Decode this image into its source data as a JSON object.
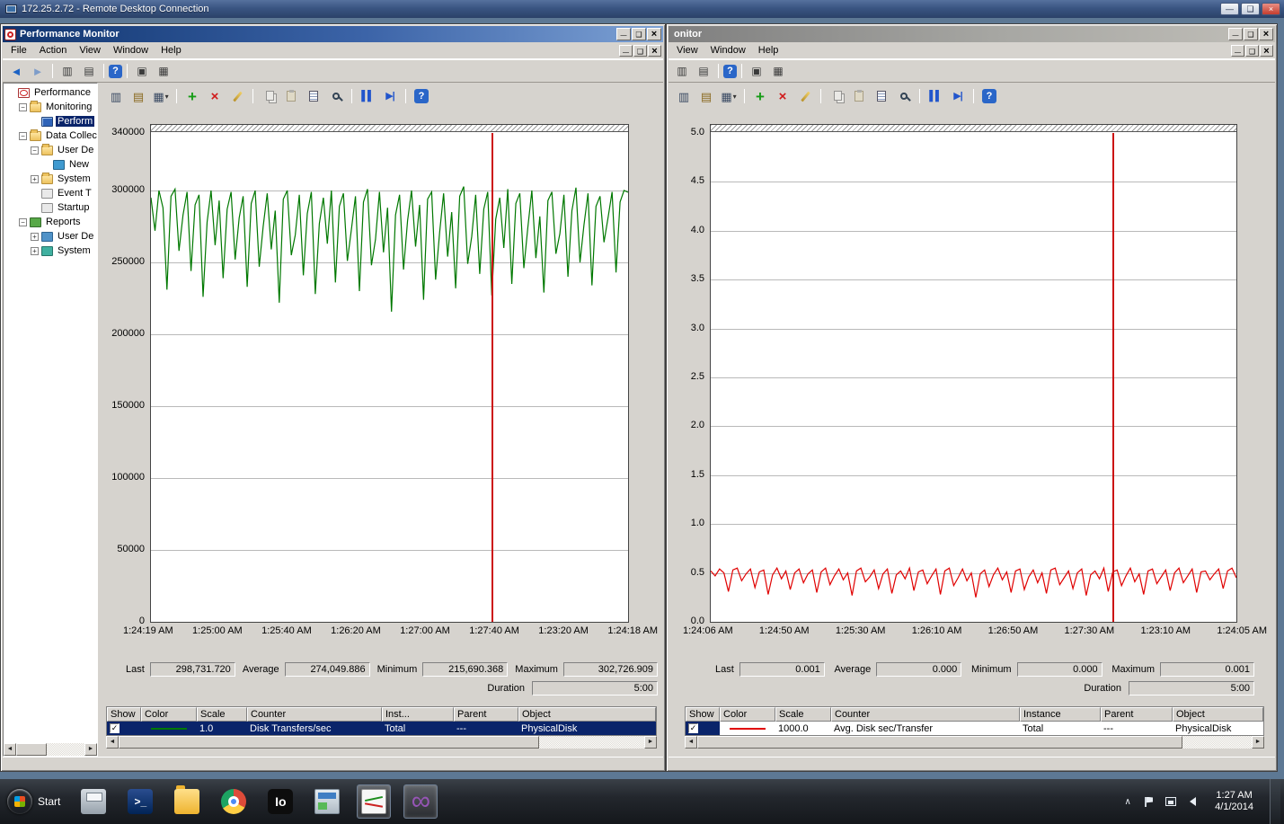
{
  "rdp": {
    "title": "172.25.2.72 - Remote Desktop Connection"
  },
  "perfmon_toolbar": [
    "view-current-activity",
    "view-log-data",
    "change-graph-type",
    "sep",
    "add-counter",
    "delete-counter",
    "highlight",
    "sep",
    "copy-properties",
    "paste-counter-list",
    "properties",
    "zoom",
    "sep",
    "freeze-display",
    "update-data",
    "sep",
    "help"
  ],
  "left_window": {
    "title": "Performance Monitor",
    "menu": [
      "File",
      "Action",
      "View",
      "Window",
      "Help"
    ],
    "toolbar_icons": [
      "back",
      "forward",
      "sep",
      "show-hide-console-tree",
      "export-list",
      "sep",
      "help",
      "sep",
      "show-window",
      "columns"
    ],
    "tree": {
      "items": [
        {
          "label": "Performance",
          "depth": 0,
          "expander": "",
          "icon": "performance",
          "selected": false
        },
        {
          "label": "Monitoring",
          "depth": 1,
          "expander": "minus",
          "icon": "folder",
          "selected": false
        },
        {
          "label": "Perform",
          "depth": 2,
          "expander": "",
          "icon": "monitor",
          "selected": true
        },
        {
          "label": "Data Collec",
          "depth": 1,
          "expander": "minus",
          "icon": "folder",
          "selected": false
        },
        {
          "label": "User De",
          "depth": 2,
          "expander": "minus",
          "icon": "user-folder",
          "selected": false
        },
        {
          "label": "New",
          "depth": 3,
          "expander": "",
          "icon": "collector",
          "selected": false
        },
        {
          "label": "System",
          "depth": 2,
          "expander": "plus",
          "icon": "system-folder",
          "selected": false
        },
        {
          "label": "Event T",
          "depth": 2,
          "expander": "",
          "icon": "event",
          "selected": false
        },
        {
          "label": "Startup",
          "depth": 2,
          "expander": "",
          "icon": "startup",
          "selected": false
        },
        {
          "label": "Reports",
          "depth": 1,
          "expander": "minus",
          "icon": "reports",
          "selected": false
        },
        {
          "label": "User De",
          "depth": 2,
          "expander": "plus",
          "icon": "user-report",
          "selected": false
        },
        {
          "label": "System",
          "depth": 2,
          "expander": "plus",
          "icon": "system-report",
          "selected": false
        }
      ]
    },
    "stats": {
      "last_label": "Last",
      "last": "298,731.720",
      "average_label": "Average",
      "average": "274,049.886",
      "minimum_label": "Minimum",
      "minimum": "215,690.368",
      "maximum_label": "Maximum",
      "maximum": "302,726.909",
      "duration_label": "Duration",
      "duration": "5:00"
    },
    "table": {
      "columns": [
        "Show",
        "Color",
        "Scale",
        "Counter",
        "Inst...",
        "Parent",
        "Object"
      ],
      "row": {
        "checked": "✓",
        "color": "#007800",
        "scale": "1.0",
        "counter": "Disk Transfers/sec",
        "instance": "Total",
        "parent": "---",
        "object": "PhysicalDisk"
      }
    }
  },
  "right_window": {
    "title": "onitor",
    "menu": [
      "View",
      "Window",
      "Help"
    ],
    "toolbar_icons": [
      "show-hide-console-tree",
      "export-list",
      "sep",
      "help",
      "sep",
      "show-window",
      "columns"
    ],
    "stats": {
      "last_label": "Last",
      "last": "0.001",
      "average_label": "Average",
      "average": "0.000",
      "minimum_label": "Minimum",
      "minimum": "0.000",
      "maximum_label": "Maximum",
      "maximum": "0.001",
      "duration_label": "Duration",
      "duration": "5:00"
    },
    "table": {
      "columns": [
        "Show",
        "Color",
        "Scale",
        "Counter",
        "Instance",
        "Parent",
        "Object"
      ],
      "row": {
        "checked": "✓",
        "color": "#e00000",
        "scale": "1000.0",
        "counter": "Avg. Disk sec/Transfer",
        "instance": "Total",
        "parent": "---",
        "object": "PhysicalDisk"
      }
    }
  },
  "chart_data": [
    {
      "type": "line",
      "window": "left",
      "title": "",
      "ylim": [
        0,
        340000
      ],
      "ytick_values": [
        0,
        50000,
        100000,
        150000,
        200000,
        250000,
        300000,
        340000
      ],
      "ytick_labels": [
        "0",
        "50000",
        "100000",
        "150000",
        "200000",
        "250000",
        "300000",
        "340000"
      ],
      "xlabels": [
        "1:24:19 AM",
        "1:25:00 AM",
        "1:25:40 AM",
        "1:26:20 AM",
        "1:27:00 AM",
        "1:27:40 AM",
        "1:23:20 AM",
        "1:24:18 AM"
      ],
      "grid": "horizontal",
      "legend": "none",
      "cursor_fraction": 0.714,
      "series": [
        {
          "name": "Disk Transfers/sec",
          "color": "#007800",
          "values": [
            295000,
            272000,
            300000,
            288000,
            231000,
            296000,
            301000,
            258000,
            283000,
            299000,
            244000,
            290000,
            297000,
            226000,
            278000,
            300000,
            262000,
            293000,
            239000,
            287000,
            299000,
            252000,
            281000,
            296000,
            233000,
            291000,
            300000,
            247000,
            275000,
            298000,
            259000,
            286000,
            222000,
            294000,
            300000,
            255000,
            269000,
            297000,
            241000,
            284000,
            299000,
            228000,
            277000,
            295000,
            263000,
            300000,
            236000,
            289000,
            298000,
            251000,
            273000,
            296000,
            230000,
            292000,
            301000,
            248000,
            266000,
            299000,
            257000,
            288000,
            215690,
            283000,
            297000,
            245000,
            279000,
            300000,
            261000,
            290000,
            224000,
            294000,
            299000,
            238000,
            271000,
            298000,
            254000,
            285000,
            232000,
            296000,
            302727,
            249000,
            268000,
            297000,
            242000,
            287000,
            299000,
            227000,
            280000,
            295000,
            260000,
            301000,
            235000,
            291000,
            298000,
            246000,
            274000,
            300000,
            253000,
            282000,
            229000,
            293000,
            299000,
            256000,
            270000,
            297000,
            240000,
            286000,
            302000,
            250000,
            276000,
            298000,
            234000,
            289000,
            296000,
            264000,
            281000,
            299000,
            243000,
            292000,
            300000,
            298731
          ]
        }
      ]
    },
    {
      "type": "line",
      "window": "right",
      "title": "",
      "ylim": [
        0,
        5
      ],
      "ytick_values": [
        0,
        0.5,
        1,
        1.5,
        2,
        2.5,
        3,
        3.5,
        4,
        4.5,
        5
      ],
      "ytick_labels": [
        "0.0",
        "0.5",
        "1.0",
        "1.5",
        "2.0",
        "2.5",
        "3.0",
        "3.5",
        "4.0",
        "4.5",
        "5.0"
      ],
      "xlabels": [
        "1:24:06 AM",
        "1:24:50 AM",
        "1:25:30 AM",
        "1:26:10 AM",
        "1:26:50 AM",
        "1:27:30 AM",
        "1:23:10 AM",
        "1:24:05 AM"
      ],
      "grid": "horizontal",
      "legend": "none",
      "cursor_fraction": 0.764,
      "series": [
        {
          "name": "Avg. Disk sec/Transfer",
          "color": "#e00000",
          "values": [
            0.52,
            0.47,
            0.54,
            0.5,
            0.31,
            0.53,
            0.55,
            0.42,
            0.49,
            0.54,
            0.35,
            0.51,
            0.53,
            0.28,
            0.48,
            0.55,
            0.44,
            0.52,
            0.33,
            0.5,
            0.54,
            0.4,
            0.49,
            0.53,
            0.3,
            0.51,
            0.55,
            0.38,
            0.47,
            0.54,
            0.43,
            0.5,
            0.27,
            0.52,
            0.55,
            0.41,
            0.46,
            0.53,
            0.34,
            0.49,
            0.54,
            0.29,
            0.48,
            0.52,
            0.44,
            0.55,
            0.32,
            0.51,
            0.53,
            0.39,
            0.47,
            0.54,
            0.28,
            0.52,
            0.55,
            0.37,
            0.45,
            0.54,
            0.42,
            0.5,
            0.25,
            0.49,
            0.53,
            0.36,
            0.48,
            0.55,
            0.43,
            0.51,
            0.3,
            0.52,
            0.54,
            0.33,
            0.46,
            0.53,
            0.4,
            0.5,
            0.29,
            0.53,
            0.55,
            0.38,
            0.45,
            0.52,
            0.34,
            0.5,
            0.54,
            0.27,
            0.48,
            0.52,
            0.44,
            0.55,
            0.31,
            0.51,
            0.53,
            0.37,
            0.47,
            0.55,
            0.41,
            0.49,
            0.28,
            0.52,
            0.54,
            0.39,
            0.46,
            0.53,
            0.32,
            0.5,
            0.55,
            0.4,
            0.47,
            0.54,
            0.3,
            0.51,
            0.52,
            0.43,
            0.49,
            0.54,
            0.34,
            0.52,
            0.55,
            0.45
          ]
        }
      ]
    }
  ],
  "taskbar": {
    "start_label": "Start",
    "icons": [
      {
        "name": "printer",
        "active": false
      },
      {
        "name": "powershell",
        "glyph": ">_",
        "active": false
      },
      {
        "name": "file-explorer",
        "active": false
      },
      {
        "name": "chrome",
        "active": false
      },
      {
        "name": "io-app",
        "glyph": "Io",
        "active": false
      },
      {
        "name": "app-window",
        "active": false
      },
      {
        "name": "performance-monitor",
        "active": true
      },
      {
        "name": "visual-studio",
        "glyph": "∞",
        "active": true
      }
    ],
    "tray_icons": [
      "expand-chevron",
      "action-center-flag",
      "network",
      "volume"
    ],
    "clock": {
      "time": "1:27 AM",
      "date": "4/1/2014"
    }
  }
}
